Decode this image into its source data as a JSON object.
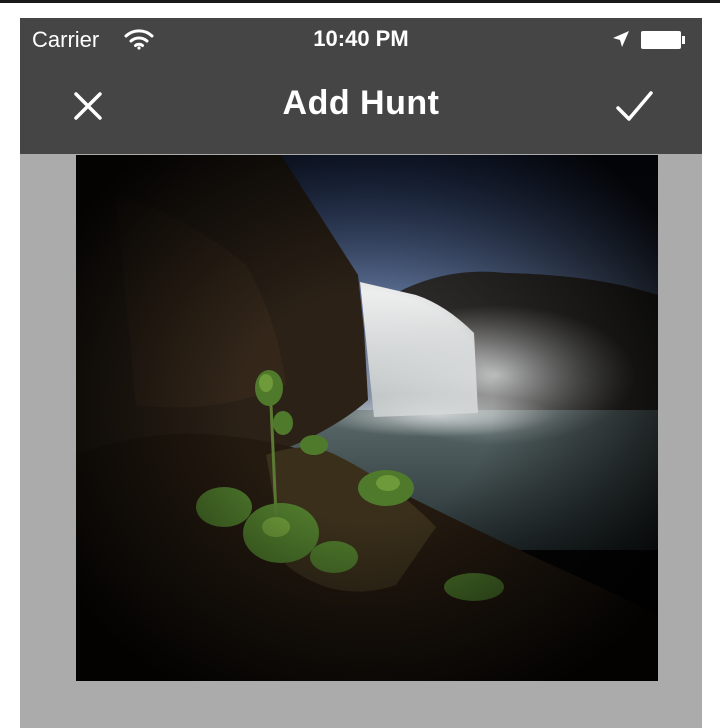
{
  "status_bar": {
    "carrier": "Carrier",
    "time": "10:40 PM",
    "icons": [
      "wifi-icon",
      "location-arrow-icon",
      "battery-icon"
    ]
  },
  "nav_bar": {
    "title": "Add Hunt",
    "left_icon": "close-icon",
    "right_icon": "checkmark-icon"
  },
  "photo": {
    "subject": "waterfall landscape photo"
  },
  "colors": {
    "bar_background": "#454545",
    "page_background": "#ababab",
    "text": "#ffffff"
  }
}
